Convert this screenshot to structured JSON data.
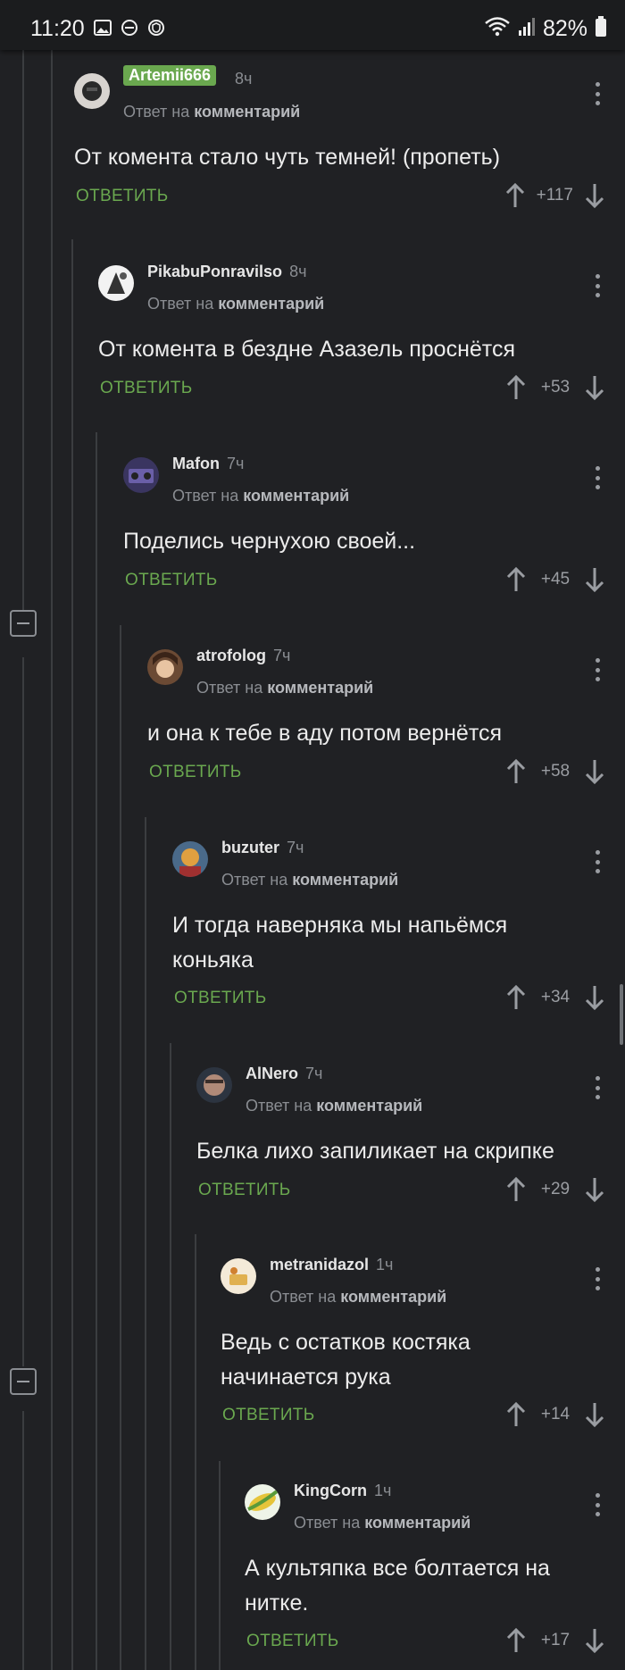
{
  "status_bar": {
    "time": "11:20",
    "battery": "82%",
    "icons": [
      "image-icon",
      "dnd-icon",
      "shield-icon",
      "wifi-icon",
      "signal-icon",
      "battery-icon"
    ]
  },
  "labels": {
    "reply_to_prefix": "Ответ на",
    "reply_to_target": "комментарий",
    "reply_button": "ОТВЕТИТЬ"
  },
  "colors": {
    "accent": "#6aa84f",
    "background": "#202124"
  },
  "comments": [
    {
      "username": "Artemii666",
      "time": "8ч",
      "text": "От комента стало чуть темней! (пропеть)",
      "score": "+117",
      "highlighted": true
    },
    {
      "username": "PikabuPonravilso",
      "time": "8ч",
      "text": "От комента в бездне Азазель проснётся",
      "score": "+53"
    },
    {
      "username": "Mafon",
      "time": "7ч",
      "text": "Поделись чернухою своей...",
      "score": "+45"
    },
    {
      "username": "atrofolog",
      "time": "7ч",
      "text": "и она к тебе в аду потом вернётся",
      "score": "+58"
    },
    {
      "username": "buzuter",
      "time": "7ч",
      "text": "И тогда наверняка мы напьёмся коньяка",
      "score": "+34"
    },
    {
      "username": "AlNero",
      "time": "7ч",
      "text": "Белка лихо запиликает на скрипке",
      "score": "+29"
    },
    {
      "username": "metranidazol",
      "time": "1ч",
      "text": "Ведь с остатков костяка начинается рука",
      "score": "+14"
    },
    {
      "username": "KingCorn",
      "time": "1ч",
      "text": "А культяпка все болтается на нитке.",
      "score": "+17"
    }
  ]
}
